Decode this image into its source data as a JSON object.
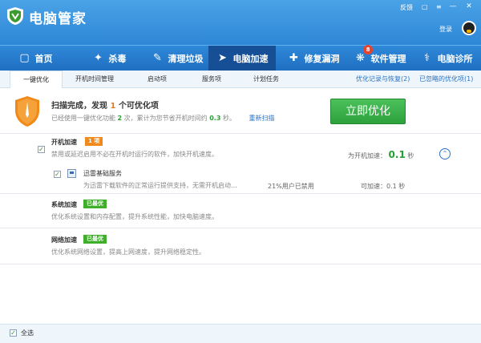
{
  "app": {
    "title": "电脑管家"
  },
  "top_links": {
    "feedback": "反馈",
    "skin_icon": "shirt-icon",
    "menu_icon": "menu-icon"
  },
  "window": {
    "minimize": "—",
    "close": "✕"
  },
  "user": {
    "login_label": "登录",
    "avatar_icon": "qq-penguin-icon"
  },
  "nav": [
    {
      "label": "首页",
      "icon": "monitor-icon"
    },
    {
      "label": "杀毒",
      "icon": "virus-icon"
    },
    {
      "label": "清理垃圾",
      "icon": "broom-icon"
    },
    {
      "label": "电脑加速",
      "icon": "rocket-icon",
      "active": true
    },
    {
      "label": "修复漏洞",
      "icon": "patch-icon"
    },
    {
      "label": "软件管理",
      "icon": "apps-icon",
      "badge": "8"
    },
    {
      "label": "电脑诊所",
      "icon": "stethoscope-icon"
    }
  ],
  "subtabs": [
    "一键优化",
    "开机时间管理",
    "启动项",
    "服务项",
    "计划任务"
  ],
  "subtab_links": {
    "history": "优化记录与恢复(2)",
    "ignored": "已忽略的优化项(1)"
  },
  "scan": {
    "title_prefix": "扫描完成，发现",
    "count": "1",
    "title_suffix": "个可优化项",
    "desc_prefix": "已经使用一键优化功能",
    "uses": "2",
    "desc_middle": "次，累计为您节省开机时间约",
    "saved": "0.3",
    "desc_suffix": "秒。",
    "rescan": "重新扫描",
    "button": "立即优化"
  },
  "boot": {
    "title": "开机加速",
    "tag": "1 项",
    "desc": "禁用或延迟启用不必在开机时运行的软件，加快开机速度。",
    "right_label": "为开机加速：",
    "right_value": "0.1",
    "right_unit": "秒",
    "item": {
      "title": "迅雷基础服务",
      "desc": "为迅雷下载软件的正常运行提供支持，无需开机启动...",
      "users": "21%用户已禁用",
      "speed": "可加速：0.1 秒"
    }
  },
  "system": {
    "title": "系统加速",
    "tag": "已最优",
    "desc": "优化系统设置和内存配置，提升系统性能，加快电脑速度。"
  },
  "network": {
    "title": "网络加速",
    "tag": "已最优",
    "desc": "优化系统网络设置，提高上网速度，提升网络稳定性。"
  },
  "footer": {
    "select_all": "全选"
  },
  "colors": {
    "header_blue": "#2e86d6",
    "nav_active": "#164f96",
    "button_green": "#3fae2a",
    "tag_orange": "#f08a1c"
  }
}
